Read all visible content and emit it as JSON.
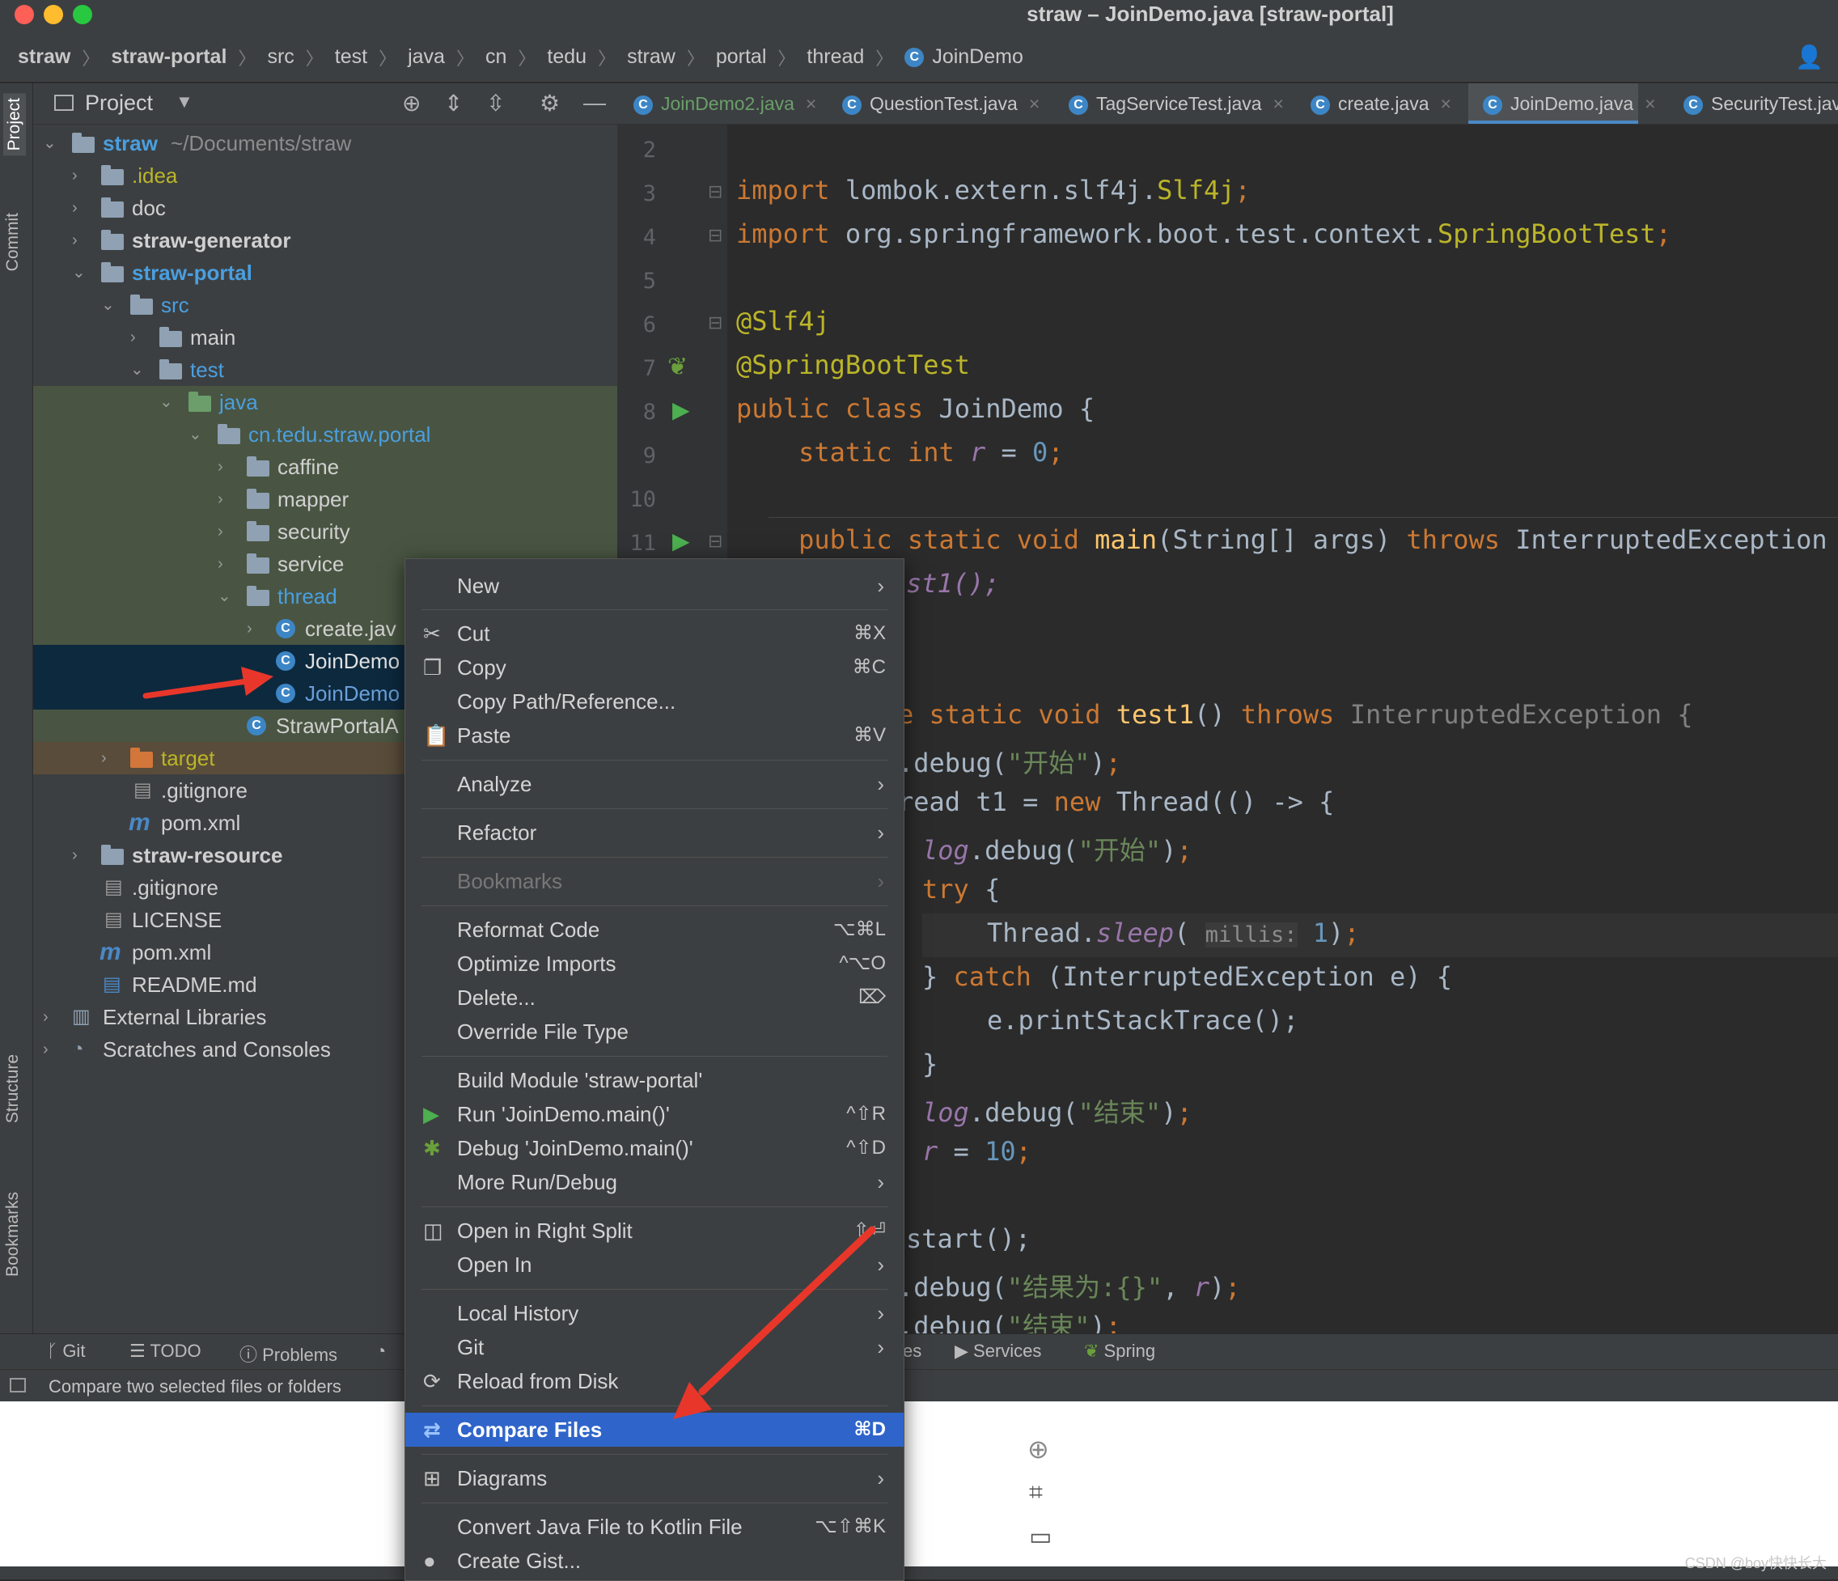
{
  "window": {
    "title": "straw – JoinDemo.java [straw-portal]"
  },
  "breadcrumb": [
    "straw",
    "straw-portal",
    "src",
    "test",
    "java",
    "cn",
    "tedu",
    "straw",
    "portal",
    "thread",
    "JoinDemo"
  ],
  "side_tabs": {
    "project": "Project",
    "commit": "Commit",
    "structure": "Structure",
    "bookmarks": "Bookmarks"
  },
  "project_panel": {
    "title": "Project",
    "tree": [
      {
        "label": "straw",
        "extra": "~/Documents/straw"
      },
      {
        "label": ".idea"
      },
      {
        "label": "doc"
      },
      {
        "label": "straw-generator"
      },
      {
        "label": "straw-portal"
      },
      {
        "label": "src"
      },
      {
        "label": "main"
      },
      {
        "label": "test"
      },
      {
        "label": "java"
      },
      {
        "label": "cn.tedu.straw.portal"
      },
      {
        "label": "caffine"
      },
      {
        "label": "mapper"
      },
      {
        "label": "security"
      },
      {
        "label": "service"
      },
      {
        "label": "thread"
      },
      {
        "label": "create.jav"
      },
      {
        "label": "JoinDemo"
      },
      {
        "label": "JoinDemo"
      },
      {
        "label": "StrawPortalA"
      },
      {
        "label": "target"
      },
      {
        "label": ".gitignore"
      },
      {
        "label": "pom.xml"
      },
      {
        "label": "straw-resource"
      },
      {
        "label": ".gitignore"
      },
      {
        "label": "LICENSE"
      },
      {
        "label": "pom.xml"
      },
      {
        "label": "README.md"
      },
      {
        "label": "External Libraries"
      },
      {
        "label": "Scratches and Consoles"
      }
    ]
  },
  "editor_tabs": [
    "JoinDemo2.java",
    "QuestionTest.java",
    "TagServiceTest.java",
    "create.java",
    "JoinDemo.java",
    "SecurityTest.java"
  ],
  "code": {
    "line_numbers": [
      "2",
      "3",
      "4",
      "5",
      "6",
      "7",
      "8",
      "9",
      "10",
      "11"
    ],
    "import1_kw": "import",
    "import1_pkg": "lombok.extern.slf4j.",
    "import1_cls": "Slf4j",
    "import2_kw": "import",
    "import2_pkg": "org.springframework.boot.test.context.",
    "import2_cls": "SpringBootTest",
    "ann1": "@Slf4j",
    "ann2": "@SpringBootTest",
    "class_kw": "public class",
    "class_name": "JoinDemo {",
    "field_kw": "static int",
    "field_name": "r",
    "field_val": "0",
    "main_kw": "public static void",
    "main_name": "main",
    "main_args": "(String[] args)",
    "main_throws": "throws",
    "main_exc": "InterruptedException",
    "l12": "st1();",
    "l15_kw": "e static void",
    "l15_name": "test1",
    "l15_throws": "throws",
    "l15_exc": "InterruptedException {",
    "l16_a": ".debug(",
    "l16_s": "\"开始\"",
    "l17_a": "read t1 = ",
    "l17_kw": "new",
    "l17_b": " Thread(() -> {",
    "l18_log": "log",
    "l18_a": ".debug(",
    "l18_s": "\"开始\"",
    "l19_kw": "try",
    "l20_a": "Thread.",
    "l20_m": "sleep",
    "l20_hint": "millis:",
    "l20_v": "1",
    "l21_a": "} ",
    "l21_kw": "catch",
    "l21_b": " (InterruptedException e) {",
    "l22": "e.printStackTrace();",
    "l23": "}",
    "l24_log": "log",
    "l24_a": ".debug(",
    "l24_s": "\"结束\"",
    "l25_r": "r",
    "l25_v": "10",
    "l27": "start();",
    "l28_a": ".debug(",
    "l28_s": "\"结果为:{}\"",
    "l28_r": "r",
    "l29_a": ".debug(",
    "l29_s": "\"结束\""
  },
  "bottom_bar": {
    "git": "Git",
    "todo": "TODO",
    "problems": "Problems",
    "services_partial": "es",
    "services": "Services",
    "spring": "Spring"
  },
  "status": {
    "text": "Compare two selected files or folders"
  },
  "context_menu": {
    "items": [
      {
        "label": "New",
        "submenu": true
      },
      {
        "label": "Cut",
        "shortcut": "⌘X"
      },
      {
        "label": "Copy",
        "shortcut": "⌘C"
      },
      {
        "label": "Copy Path/Reference..."
      },
      {
        "label": "Paste",
        "shortcut": "⌘V"
      },
      {
        "label": "Analyze",
        "submenu": true
      },
      {
        "label": "Refactor",
        "submenu": true
      },
      {
        "label": "Bookmarks",
        "submenu": true,
        "disabled": true
      },
      {
        "label": "Reformat Code",
        "shortcut": "⌥⌘L"
      },
      {
        "label": "Optimize Imports",
        "shortcut": "^⌥O"
      },
      {
        "label": "Delete...",
        "shortcut": "⌦"
      },
      {
        "label": "Override File Type"
      },
      {
        "label": "Build Module 'straw-portal'"
      },
      {
        "label": "Run 'JoinDemo.main()'",
        "shortcut": "^⇧R"
      },
      {
        "label": "Debug 'JoinDemo.main()'",
        "shortcut": "^⇧D"
      },
      {
        "label": "More Run/Debug",
        "submenu": true
      },
      {
        "label": "Open in Right Split",
        "shortcut": "⇧⏎"
      },
      {
        "label": "Open In",
        "submenu": true
      },
      {
        "label": "Local History",
        "submenu": true
      },
      {
        "label": "Git",
        "submenu": true
      },
      {
        "label": "Reload from Disk"
      },
      {
        "label": "Compare Files",
        "shortcut": "⌘D",
        "selected": true
      },
      {
        "label": "Diagrams",
        "submenu": true
      },
      {
        "label": "Convert Java File to Kotlin File",
        "shortcut": "⌥⇧⌘K"
      },
      {
        "label": "Create Gist..."
      }
    ]
  },
  "watermark": "CSDN @boy快快长大",
  "colors": {
    "selection": "#2f65ca",
    "arrow": "#e8372a",
    "accent_blue": "#4a88c7"
  }
}
